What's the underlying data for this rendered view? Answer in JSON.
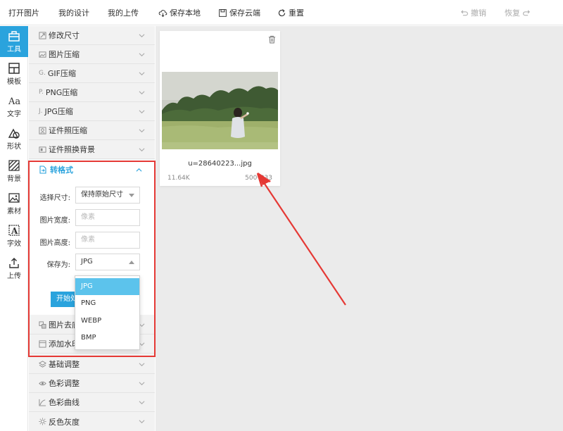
{
  "toolbar": {
    "open_image": "打开图片",
    "my_designs": "我的设计",
    "my_uploads": "我的上传",
    "save_local": "保存本地",
    "save_cloud": "保存云端",
    "reset": "重置",
    "undo": "撤销",
    "redo": "恢复"
  },
  "sidebar": {
    "items": [
      {
        "label": "工具",
        "icon": "toolbox-icon",
        "active": true
      },
      {
        "label": "模板",
        "icon": "template-icon"
      },
      {
        "label": "文字",
        "icon": "text-icon"
      },
      {
        "label": "形状",
        "icon": "shape-icon"
      },
      {
        "label": "背景",
        "icon": "background-icon"
      },
      {
        "label": "素材",
        "icon": "image-icon"
      },
      {
        "label": "字效",
        "icon": "text-effect-icon"
      },
      {
        "label": "上传",
        "icon": "upload-icon"
      }
    ]
  },
  "tools": {
    "resize": "修改尺寸",
    "compress": "图片压缩",
    "gif_glyph": "G.",
    "gif": "GIF压缩",
    "png_glyph": "P.",
    "png": "PNG压缩",
    "jpg_glyph": "J.",
    "jpg": "JPG压缩",
    "id_compress": "证件照压缩",
    "id_bg": "证件照换背景",
    "convert": "转格式",
    "remove_bg": "图片去底",
    "watermark": "添加水印",
    "basic_adjust": "基础调整",
    "color_adjust": "色彩调整",
    "curves": "色彩曲线",
    "invert_gray": "反色灰度"
  },
  "convert_form": {
    "size_label": "选择尺寸:",
    "size_value": "保持原始尺寸",
    "width_label": "图片宽度:",
    "width_placeholder": "像素",
    "height_label": "图片高度:",
    "height_placeholder": "像素",
    "saveas_label": "保存为:",
    "saveas_value": "JPG",
    "start_button": "开始处",
    "options": [
      "JPG",
      "PNG",
      "WEBP",
      "BMP"
    ],
    "selected_option": "JPG"
  },
  "card": {
    "filename": "u=28640223...jpg",
    "filesize": "11.64K",
    "dimensions": "500*333"
  },
  "colors": {
    "accent": "#2aa3dd",
    "highlight": "#e53935",
    "selected_option": "#5cc3ec"
  }
}
